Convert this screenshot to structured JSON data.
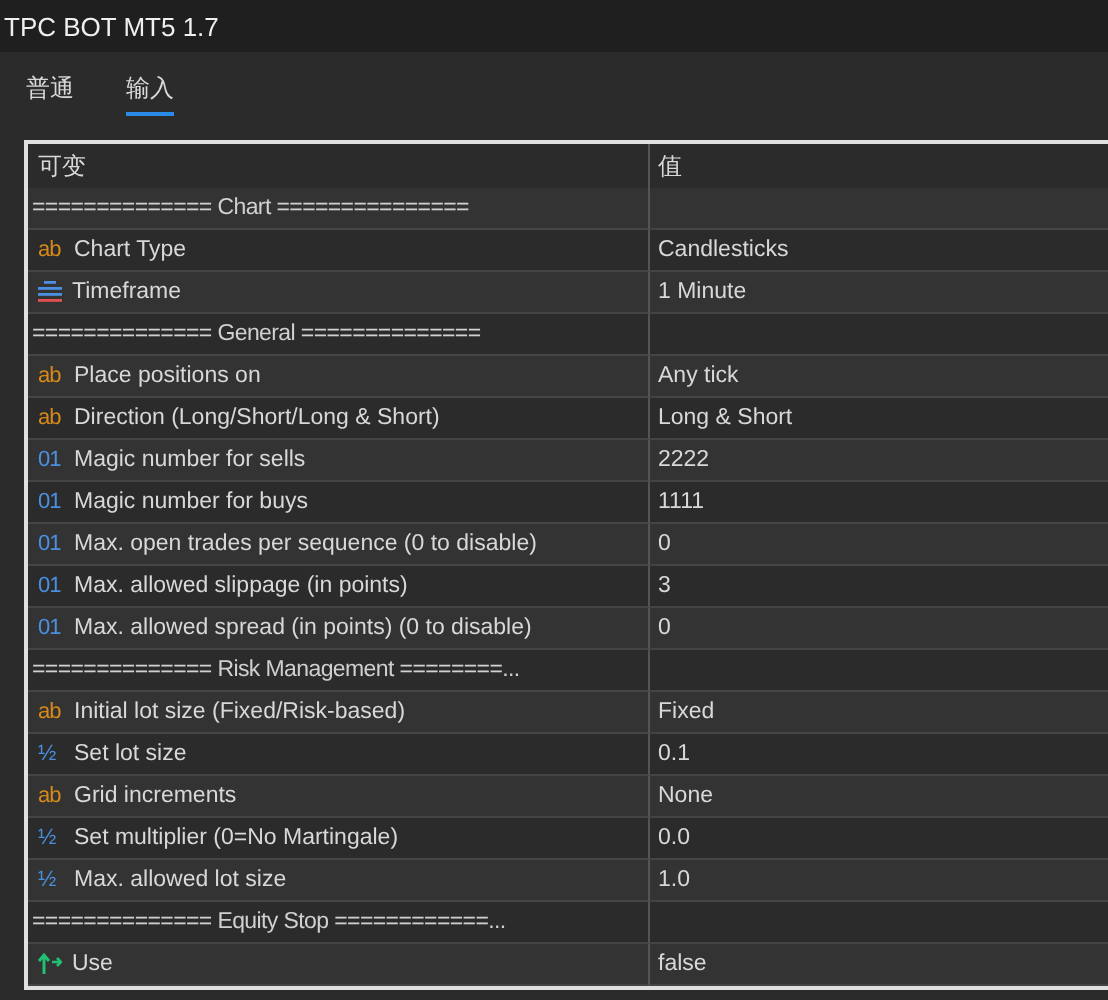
{
  "window": {
    "title": "TPC BOT MT5 1.7"
  },
  "tabs": [
    {
      "label": "普通",
      "selected": false
    },
    {
      "label": "输入",
      "selected": true
    }
  ],
  "table": {
    "columns": [
      "可变",
      "值"
    ],
    "rows": [
      {
        "kind": "section",
        "name": "============== Chart ==============="
      },
      {
        "kind": "string",
        "icon_text": "ab",
        "name": "Chart Type",
        "value": "Candlesticks"
      },
      {
        "kind": "enum",
        "name": "Timeframe",
        "value": "1 Minute"
      },
      {
        "kind": "section",
        "name": "============== General =============="
      },
      {
        "kind": "string",
        "icon_text": "ab",
        "name": "Place positions on",
        "value": "Any tick"
      },
      {
        "kind": "string",
        "icon_text": "ab",
        "name": "Direction (Long/Short/Long & Short)",
        "value": "Long & Short"
      },
      {
        "kind": "int",
        "icon_text": "01",
        "name": "Magic number for sells",
        "value": "2222"
      },
      {
        "kind": "int",
        "icon_text": "01",
        "name": "Magic number for buys",
        "value": "1111"
      },
      {
        "kind": "int",
        "icon_text": "01",
        "name": "Max. open trades per sequence (0 to disable)",
        "value": "0"
      },
      {
        "kind": "int",
        "icon_text": "01",
        "name": "Max. allowed slippage (in points)",
        "value": "3"
      },
      {
        "kind": "int",
        "icon_text": "01",
        "name": "Max. allowed spread (in points) (0 to disable)",
        "value": "0"
      },
      {
        "kind": "section",
        "name": "============== Risk Management ========..."
      },
      {
        "kind": "string",
        "icon_text": "ab",
        "name": "Initial lot size (Fixed/Risk-based)",
        "value": "Fixed"
      },
      {
        "kind": "double",
        "icon_text": "½",
        "name": "Set lot size",
        "value": "0.1"
      },
      {
        "kind": "string",
        "icon_text": "ab",
        "name": "Grid increments",
        "value": "None"
      },
      {
        "kind": "double",
        "icon_text": "½",
        "name": "Set multiplier (0=No Martingale)",
        "value": "0.0"
      },
      {
        "kind": "double",
        "icon_text": "½",
        "name": "Max. allowed lot size",
        "value": "1.0"
      },
      {
        "kind": "section",
        "name": "============== Equity Stop ============..."
      },
      {
        "kind": "bool",
        "name": "Use",
        "value": "false"
      }
    ]
  }
}
